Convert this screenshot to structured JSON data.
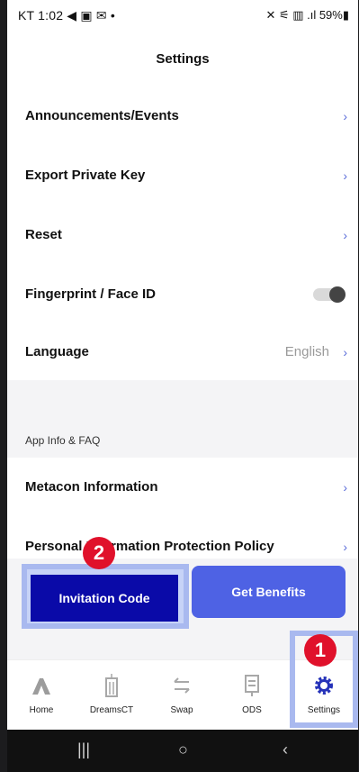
{
  "status": {
    "left": "KT 1:02 ◀ ▣ ✉ •",
    "right": "✕ ⚟ ▥ .ıl 59%▮"
  },
  "header": {
    "title": "Settings"
  },
  "menu": {
    "announcements": "Announcements/Events",
    "export_key": "Export Private Key",
    "reset": "Reset",
    "fingerprint": "Fingerprint / Face ID",
    "language": "Language",
    "language_value": "English",
    "chevron": "›"
  },
  "section": {
    "app_info_label": "App Info & FAQ"
  },
  "menu2": {
    "metacon": "Metacon Information",
    "privacy": "Personal Information Protection Policy"
  },
  "buttons": {
    "invitation": "Invitation Code",
    "benefits": "Get Benefits"
  },
  "badges": {
    "one": "1",
    "two": "2"
  },
  "tabs": [
    {
      "label": "Home",
      "icon": "home-icon"
    },
    {
      "label": "DreamsCT",
      "icon": "building-icon"
    },
    {
      "label": "Swap",
      "icon": "swap-icon"
    },
    {
      "label": "ODS",
      "icon": "ods-icon"
    },
    {
      "label": "Settings",
      "icon": "gear-icon"
    }
  ],
  "toggle_on": false,
  "colors": {
    "accent": "#4e62e4",
    "invite": "#0a0aa8",
    "badge": "#e0112b",
    "highlight_frame": "#a9b9ef"
  }
}
